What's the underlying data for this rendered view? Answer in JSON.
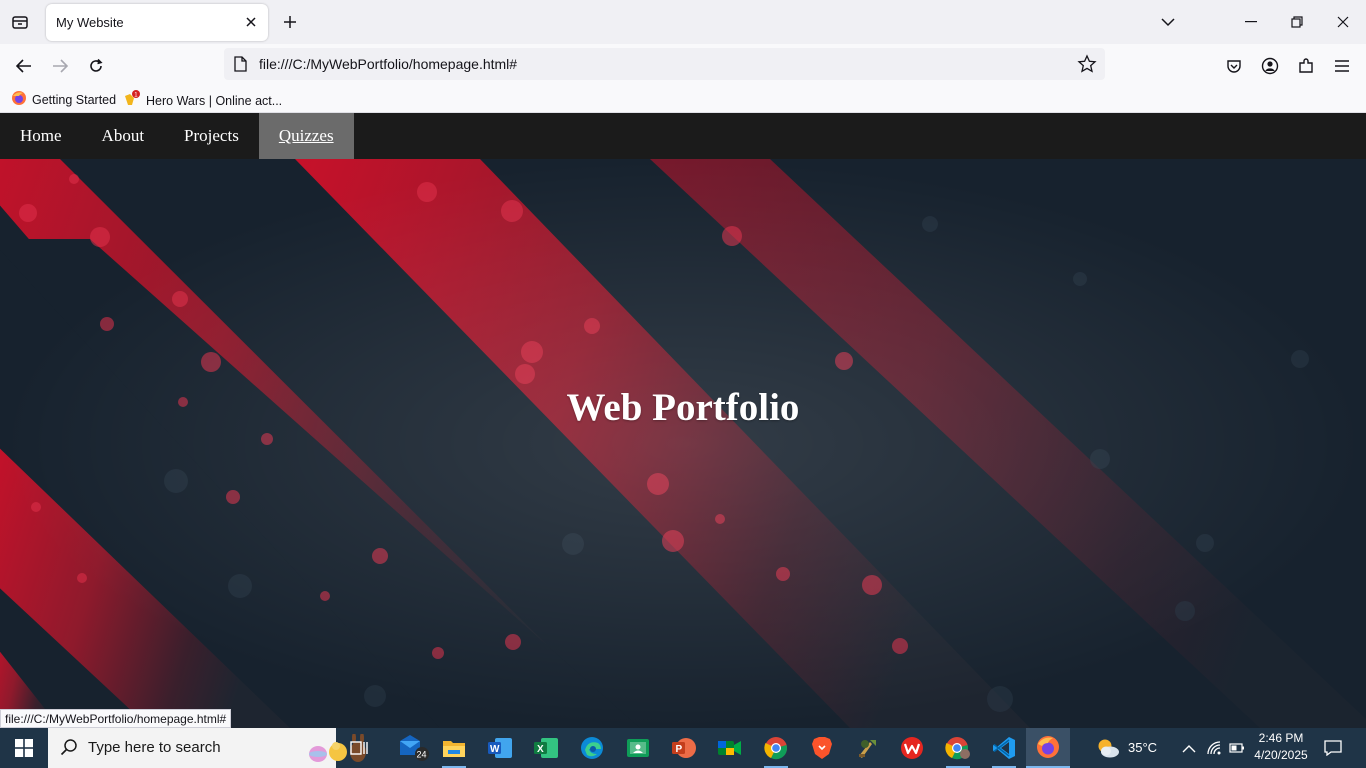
{
  "browser": {
    "tab_title": "My Website",
    "url": "file:///C:/MyWebPortfolio/homepage.html#",
    "bookmarks": [
      {
        "label": "Getting Started",
        "icon": "firefox-icon"
      },
      {
        "label": "Hero Wars | Online act...",
        "icon": "hero-wars-icon"
      }
    ],
    "status_url": "file:///C:/MyWebPortfolio/homepage.html#"
  },
  "site": {
    "nav": [
      {
        "label": "Home",
        "active": false
      },
      {
        "label": "About",
        "active": false
      },
      {
        "label": "Projects",
        "active": false
      },
      {
        "label": "Quizzes",
        "active": true
      }
    ],
    "hero_title": "Web Portfolio",
    "hero_colors": {
      "dark": "#17222e",
      "red": "#c0102a",
      "red_faded": "#3a1f2a"
    }
  },
  "taskbar": {
    "search_placeholder": "Type here to search",
    "mail_badge": "24",
    "weather": "35°C",
    "time": "2:46 PM",
    "date": "4/20/2025",
    "apps": [
      "task-view-icon",
      "mail-icon",
      "file-explorer-icon",
      "word-icon",
      "excel-icon",
      "edge-icon",
      "classroom-icon",
      "powerpoint-icon",
      "meet-icon",
      "chrome-icon",
      "brave-icon",
      "game-icon",
      "wps-icon",
      "chrome-profile-icon",
      "vscode-icon",
      "firefox-icon"
    ]
  }
}
